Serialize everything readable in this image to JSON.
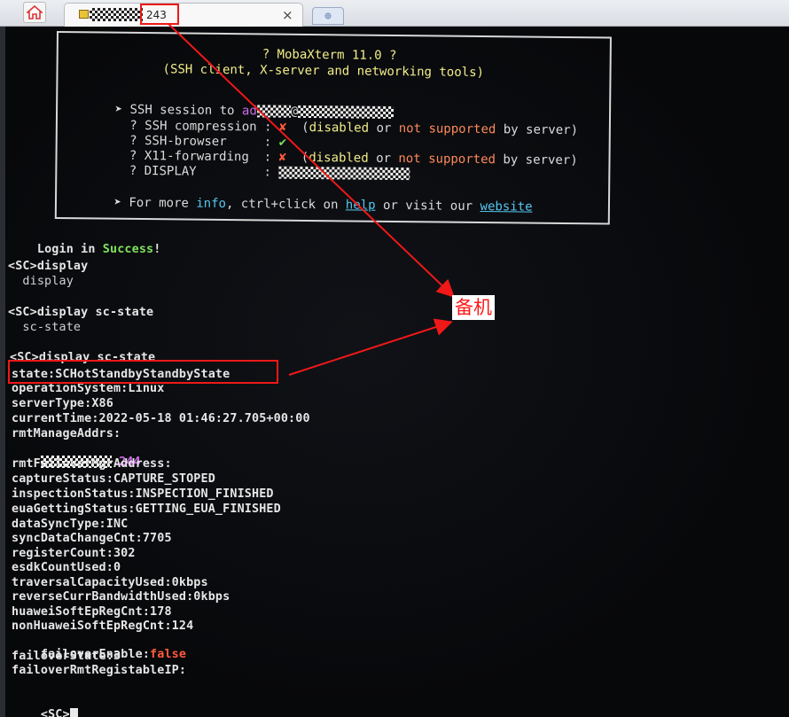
{
  "tabbar": {
    "tab_title": "243",
    "close_symbol": "×",
    "new_tab_symbol": "⊕"
  },
  "banner": {
    "title": "? MobaXterm 11.0 ?",
    "subtitle": "(SSH client, X-server and networking tools)",
    "session_label": "➤ SSH session to ",
    "session_host_partial": "ad",
    "session_host_at": "@",
    "compression_label": "  ? SSH compression : ",
    "browser_label": "  ? SSH-browser     : ",
    "x11_label": "  ? X11-forwarding  : ",
    "display_label": "  ? DISPLAY         : ",
    "cross_symbol": "✘",
    "check_symbol": "✔",
    "disabled": "disabled",
    "or": " or ",
    "not_supported": "not supported",
    "by_server": " by server)",
    "open_paren": "  (",
    "info_prefix": "➤ For more ",
    "info_word": "info",
    "info_middle": ", ctrl+click on ",
    "help_word": "help",
    "visit": " or visit our ",
    "website_word": "website"
  },
  "terminal": {
    "login_prefix": "Login in ",
    "login_success": "Success",
    "login_suffix": "!",
    "cmd1": "<SC>display",
    "cmd1_echo": "  display",
    "cmd2": "<SC>display sc-state",
    "cmd2_echo": "  sc-state",
    "cmd3": "<SC>display sc-state",
    "state": "state:SCHotStandbyStandbyState",
    "operationSystem": "operationSystem:Linux",
    "serverType": "serverType:X86",
    "currentTime": "currentTime:2022-05-18 01:46:27.705+00:00",
    "rmtManageAddrs": "rmtManageAddrs:",
    "rmtManageAddrs_value_suffix": ".244",
    "rmtFailoverMgrAddress": "rmtFailoverMgrAddress:",
    "captureStatus": "captureStatus:CAPTURE_STOPED",
    "inspectionStatus": "inspectionStatus:INSPECTION_FINISHED",
    "euaGettingStatus": "euaGettingStatus:GETTING_EUA_FINISHED",
    "dataSyncType": "dataSyncType:INC",
    "syncDataChangeCnt": "syncDataChangeCnt:7705",
    "registerCount": "registerCount:302",
    "esdkCountUsed": "esdkCountUsed:0",
    "traversalCapacityUsed": "traversalCapacityUsed:0kbps",
    "reverseCurrBandwidthUsed": "reverseCurrBandwidthUsed:0kbps",
    "huaweiSoftEpRegCnt": "huaweiSoftEpRegCnt:178",
    "nonHuaweiSoftEpRegCnt": "nonHuaweiSoftEpRegCnt:124",
    "failoverEnable_label": "failoverEnable:",
    "failoverEnable_value": "false",
    "failoverState": "failoverState:3",
    "failoverRmtRegistableIP": "failoverRmtRegistableIP:",
    "prompt": "<SC>"
  },
  "annotation": {
    "label": "备机"
  },
  "colors": {
    "annotation_red": "#f01818",
    "success_green": "#7ee35d",
    "false_red": "#ff5b3d"
  },
  "icons": {
    "home": "home-icon",
    "session": "terminal-session-icon",
    "close": "close-icon",
    "new_tab": "new-tab-icon"
  }
}
